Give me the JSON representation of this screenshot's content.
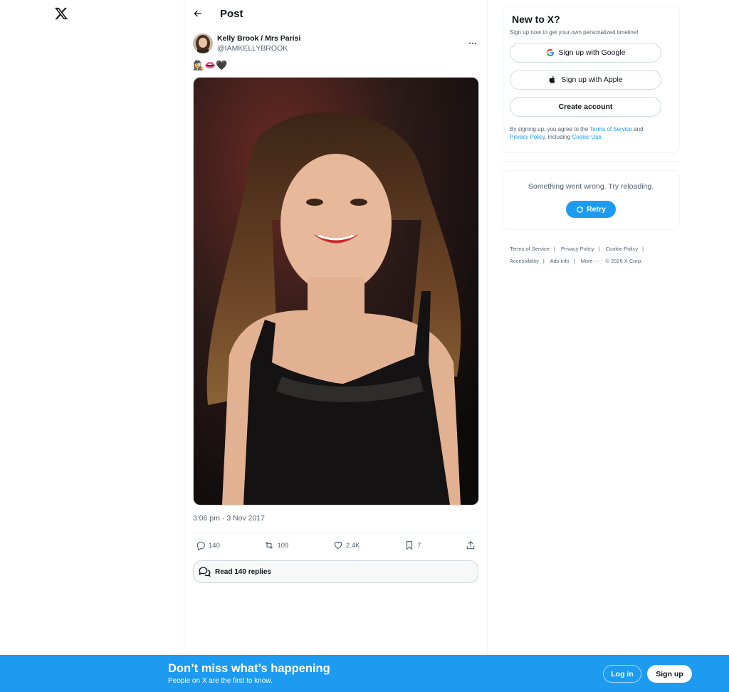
{
  "nav": {
    "logo_icon": "x-logo-icon"
  },
  "header": {
    "title": "Post",
    "back_icon": "arrow-left-icon"
  },
  "tweet": {
    "author_name": "Kelly Brook / Mrs Parisi",
    "author_handle": "@IAMKELLYBROOK",
    "text": "🕵️‍♀️👄🖤",
    "timestamp": "3:06 pm · 3 Nov 2017",
    "actions": {
      "replies": "140",
      "reposts": "109",
      "likes": "2.4K",
      "bookmarks": "7"
    },
    "read_replies_label": "Read 140 replies"
  },
  "sidebar": {
    "signup": {
      "title": "New to X?",
      "subtitle": "Sign up now to get your own personalized timeline!",
      "google_label": "Sign up with Google",
      "apple_label": "Sign up with Apple",
      "create_label": "Create account",
      "legal_prefix": "By signing up, you agree to the ",
      "terms_link": "Terms of Service",
      "legal_and": " and",
      "privacy_link": "Privacy Policy",
      "legal_including": ", including ",
      "cookie_link": "Cookie Use."
    },
    "error": {
      "message": "Something went wrong. Try reloading.",
      "retry_label": "Retry"
    },
    "footer": {
      "terms": "Terms of Service",
      "privacy": "Privacy Policy",
      "cookie": "Cookie Policy",
      "accessibility": "Accessibility",
      "ads": "Ads info",
      "more": "More ···",
      "copyright": "© 2026 X Corp."
    }
  },
  "bottom_bar": {
    "title": "Don’t miss what’s happening",
    "subtitle": "People on X are the first to know.",
    "login_label": "Log in",
    "signup_label": "Sign up"
  },
  "colors": {
    "accent": "#1d9bf0",
    "text": "#0f1419",
    "muted": "#536471"
  }
}
